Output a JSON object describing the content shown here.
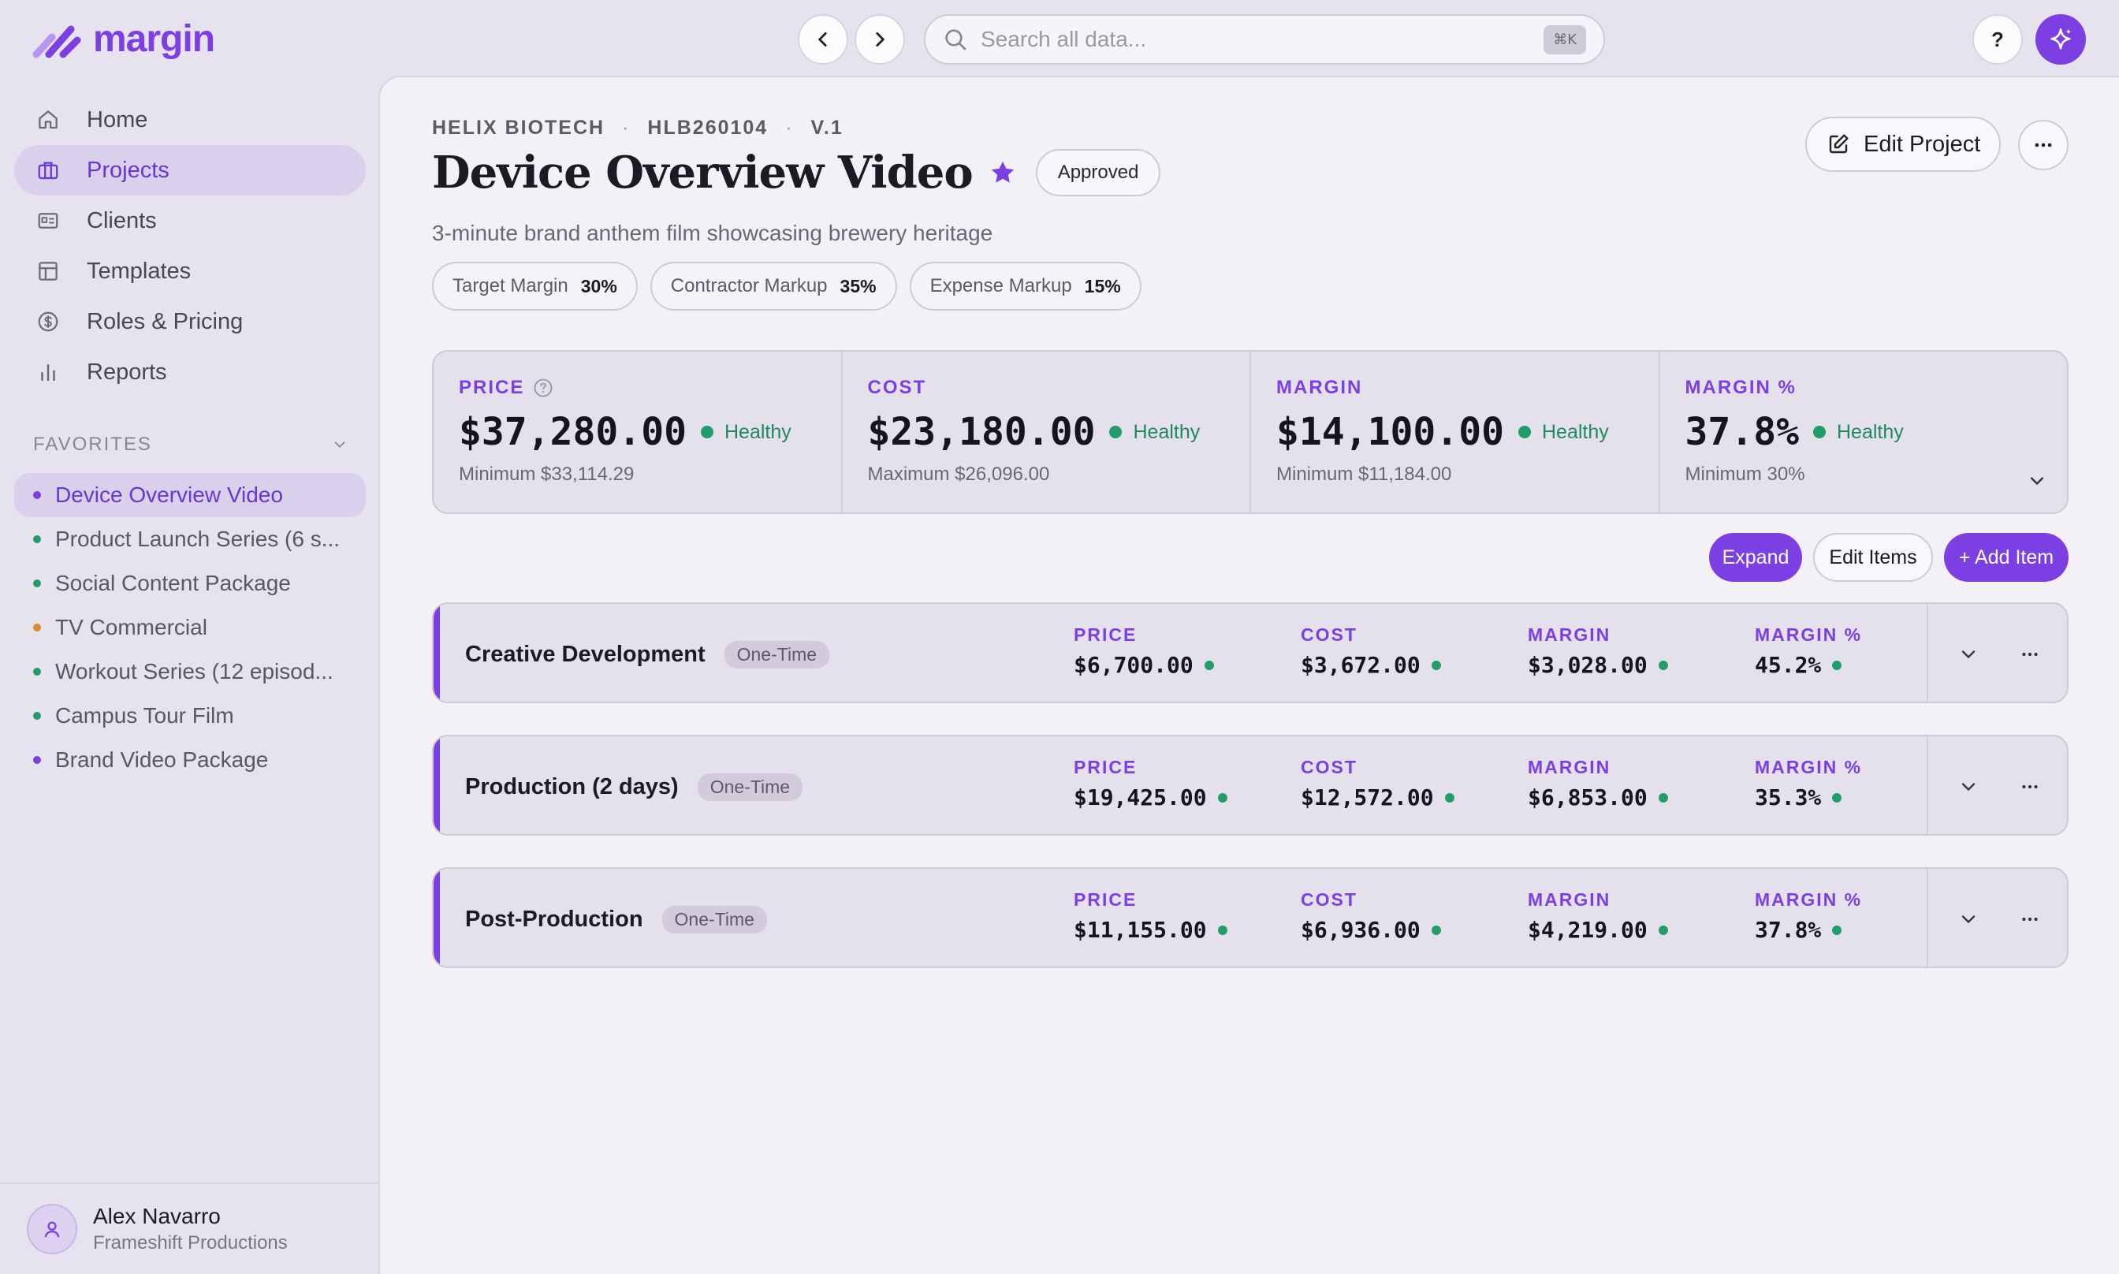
{
  "app": {
    "name": "margin",
    "brand_color": "#7b3fe4"
  },
  "search": {
    "placeholder": "Search all data...",
    "shortcut": "⌘K"
  },
  "topbar": {
    "help_label": "?"
  },
  "sidebar": {
    "items": [
      {
        "label": "Home",
        "icon": "home-icon"
      },
      {
        "label": "Projects",
        "icon": "briefcase-icon",
        "active": true
      },
      {
        "label": "Clients",
        "icon": "id-card-icon"
      },
      {
        "label": "Templates",
        "icon": "layout-icon"
      },
      {
        "label": "Roles & Pricing",
        "icon": "dollar-circle-icon"
      },
      {
        "label": "Reports",
        "icon": "bar-chart-icon"
      }
    ],
    "favorites_label": "FAVORITES",
    "favorites": [
      {
        "label": "Device Overview Video",
        "color": "#7b3fe4",
        "active": true
      },
      {
        "label": "Product Launch Series (6 s...",
        "color": "#1f9e6a"
      },
      {
        "label": "Social Content Package",
        "color": "#1f9e6a"
      },
      {
        "label": "TV Commercial",
        "color": "#d98a2b"
      },
      {
        "label": "Workout Series (12 episod...",
        "color": "#1f9e6a"
      },
      {
        "label": "Campus Tour Film",
        "color": "#1f9e6a"
      },
      {
        "label": "Brand Video Package",
        "color": "#7b3fe4"
      }
    ]
  },
  "user": {
    "name": "Alex Navarro",
    "org": "Frameshift Productions"
  },
  "project": {
    "client": "HELIX BIOTECH",
    "code": "HLB260104",
    "version": "V.1",
    "title": "Device Overview Video",
    "status": "Approved",
    "description": "3-minute brand anthem film showcasing brewery heritage",
    "chips": [
      {
        "label": "Target Margin",
        "value": "30%"
      },
      {
        "label": "Contractor Markup",
        "value": "35%"
      },
      {
        "label": "Expense Markup",
        "value": "15%"
      }
    ],
    "edit_label": "Edit Project"
  },
  "summary": [
    {
      "label": "PRICE",
      "value": "$37,280.00",
      "health": "Healthy",
      "sub": "Minimum $33,114.29",
      "has_help": true
    },
    {
      "label": "COST",
      "value": "$23,180.00",
      "health": "Healthy",
      "sub": "Maximum $26,096.00"
    },
    {
      "label": "MARGIN",
      "value": "$14,100.00",
      "health": "Healthy",
      "sub": "Minimum $11,184.00"
    },
    {
      "label": "MARGIN %",
      "value": "37.8%",
      "health": "Healthy",
      "sub": "Minimum 30%"
    }
  ],
  "actions": {
    "expand": "Expand",
    "edit_items": "Edit Items",
    "add_item": "+ Add Item"
  },
  "metric_labels": {
    "price": "PRICE",
    "cost": "COST",
    "margin": "MARGIN",
    "margin_pct": "MARGIN %"
  },
  "items": [
    {
      "name": "Creative Development",
      "tag": "One-Time",
      "price": "$6,700.00",
      "cost": "$3,672.00",
      "margin": "$3,028.00",
      "margin_pct": "45.2%"
    },
    {
      "name": "Production (2 days)",
      "tag": "One-Time",
      "price": "$19,425.00",
      "cost": "$12,572.00",
      "margin": "$6,853.00",
      "margin_pct": "35.3%"
    },
    {
      "name": "Post-Production",
      "tag": "One-Time",
      "price": "$11,155.00",
      "cost": "$6,936.00",
      "margin": "$4,219.00",
      "margin_pct": "37.8%"
    }
  ]
}
